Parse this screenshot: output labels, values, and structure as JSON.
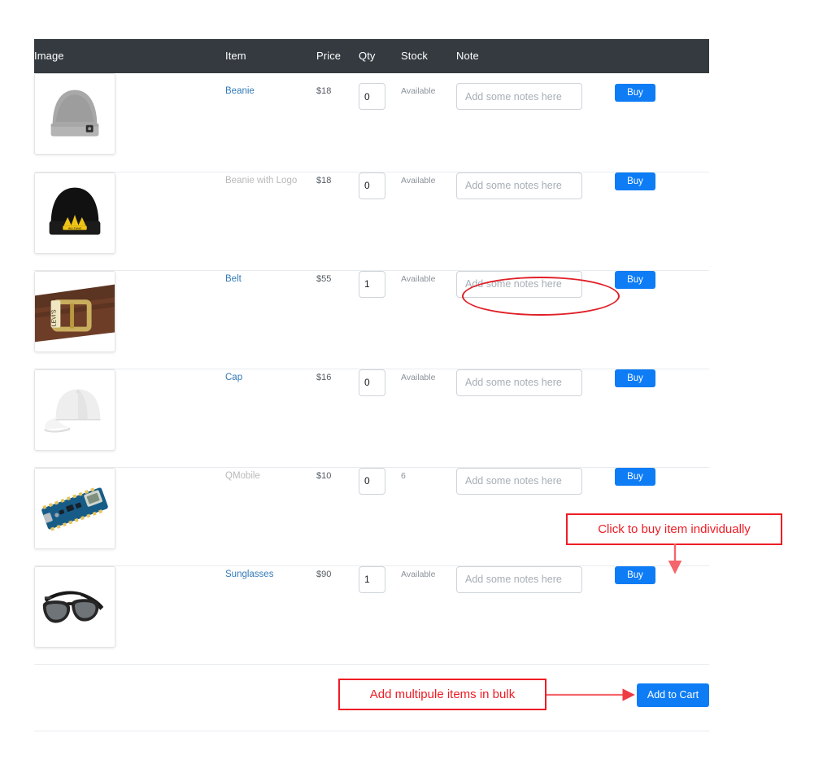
{
  "table": {
    "columns": [
      "Image",
      "Item",
      "Price",
      "Qty",
      "Stock",
      "Note",
      ""
    ],
    "rows": [
      {
        "image_alt": "gray-beanie",
        "item": "Beanie",
        "item_is_link": true,
        "price": "$18",
        "qty": "0",
        "stock": "Available",
        "note_value": "",
        "note_placeholder": "Add some notes here",
        "buy_label": "Buy"
      },
      {
        "image_alt": "black-beanie-with-logo",
        "item": "Beanie with Logo",
        "item_is_link": false,
        "price": "$18",
        "qty": "0",
        "stock": "Available",
        "note_value": "",
        "note_placeholder": "Add some notes here",
        "buy_label": "Buy"
      },
      {
        "image_alt": "brown-leather-belt",
        "item": "Belt",
        "item_is_link": true,
        "price": "$55",
        "qty": "1",
        "stock": "Available",
        "note_value": "",
        "note_placeholder": "Add some notes here",
        "buy_label": "Buy"
      },
      {
        "image_alt": "white-baseball-cap",
        "item": "Cap",
        "item_is_link": true,
        "price": "$16",
        "qty": "0",
        "stock": "Available",
        "note_value": "",
        "note_placeholder": "Add some notes here",
        "buy_label": "Buy"
      },
      {
        "image_alt": "microcontroller-board",
        "item": "QMobile",
        "item_is_link": false,
        "price": "$10",
        "qty": "0",
        "stock": "6",
        "note_value": "",
        "note_placeholder": "Add some notes here",
        "buy_label": "Buy"
      },
      {
        "image_alt": "black-sunglasses",
        "item": "Sunglasses",
        "item_is_link": true,
        "price": "$90",
        "qty": "1",
        "stock": "Available",
        "note_value": "",
        "note_placeholder": "Add some notes here",
        "buy_label": "Buy"
      }
    ]
  },
  "footer": {
    "add_to_cart_label": "Add to Cart"
  },
  "annotations": {
    "buy_note": "Click to buy item individually",
    "bulk_note": "Add multipule items in bulk",
    "ellipse_target": "note-field-belt"
  },
  "colors": {
    "header_bg": "#343a40",
    "primary_button": "#0d7cf5",
    "link": "#337ab7",
    "annotation_red": "#ee1c25",
    "muted_text": "#8a9199"
  }
}
